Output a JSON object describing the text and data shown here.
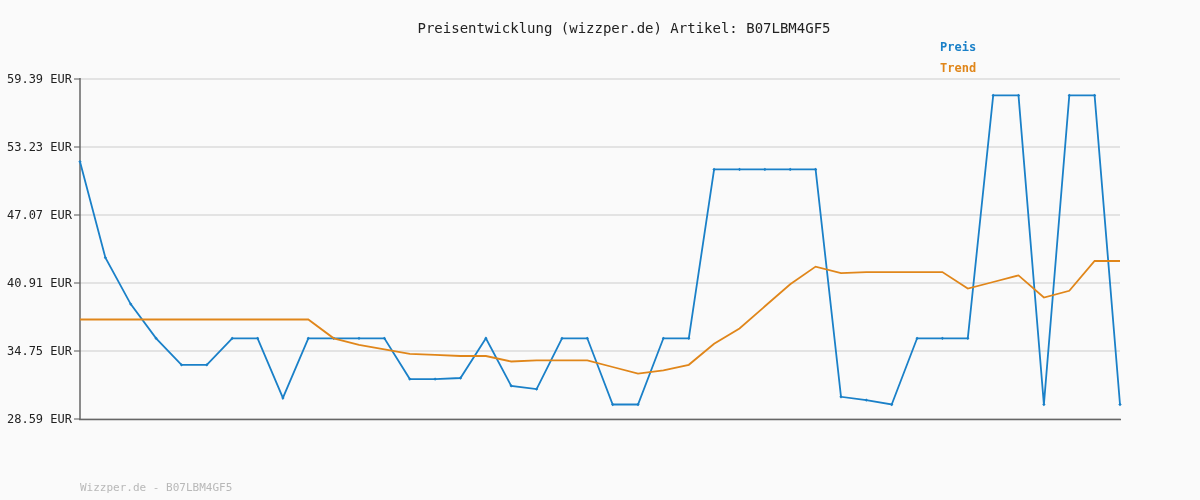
{
  "chart": {
    "chart_data": {
      "type": "line",
      "title": "Preisentwicklung (wizzper.de) Artikel: B07LBM4GF5",
      "grid": true,
      "ylim": [
        28.59,
        59.39
      ],
      "yticks": [
        {
          "value": 28.59,
          "label": "28.59 EUR"
        },
        {
          "value": 34.75,
          "label": "34.75 EUR"
        },
        {
          "value": 40.91,
          "label": "40.91 EUR"
        },
        {
          "value": 47.07,
          "label": "47.07 EUR"
        },
        {
          "value": 53.23,
          "label": "53.23 EUR"
        },
        {
          "value": 59.39,
          "label": "59.39 EUR"
        }
      ],
      "series": [
        {
          "name": "Preis",
          "color": "#1a80c8",
          "values": [
            51.9,
            43.2,
            39,
            35.9,
            33.5,
            33.5,
            35.9,
            35.9,
            30.5,
            35.9,
            35.9,
            35.9,
            35.9,
            32.2,
            32.2,
            32.3,
            35.9,
            31.6,
            31.3,
            35.9,
            35.9,
            29.9,
            29.9,
            35.9,
            35.9,
            51.2,
            51.2,
            51.2,
            51.2,
            51.2,
            30.6,
            30.3,
            29.9,
            35.9,
            35.9,
            35.9,
            57.9,
            57.9,
            29.9,
            57.9,
            57.9,
            29.9
          ]
        },
        {
          "name": "Trend",
          "color": "#e0861a",
          "values": [
            37.6,
            37.6,
            37.6,
            37.6,
            37.6,
            37.6,
            37.6,
            37.6,
            37.6,
            37.6,
            35.9,
            35.3,
            34.9,
            34.5,
            34.4,
            34.3,
            34.3,
            33.8,
            33.9,
            33.9,
            33.9,
            33.3,
            32.7,
            33,
            33.5,
            35.4,
            36.8,
            38.8,
            40.8,
            42.4,
            41.8,
            41.9,
            41.9,
            41.9,
            41.9,
            40.4,
            41,
            41.6,
            39.6,
            40.2,
            42.9,
            42.9
          ]
        }
      ]
    }
  },
  "footer": "Wizzper.de - B07LBM4GF5"
}
